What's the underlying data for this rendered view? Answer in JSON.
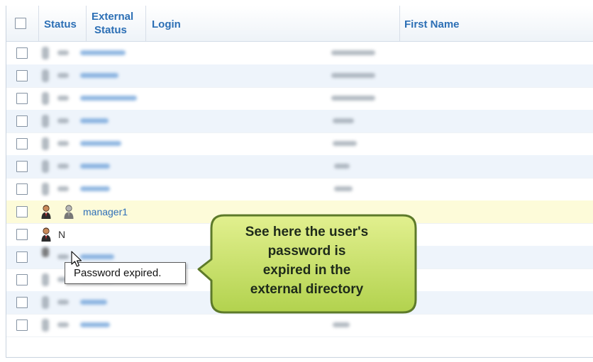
{
  "header": {
    "status": "Status",
    "external_status_line1": "External",
    "external_status_line2": "Status",
    "login": "Login",
    "first_name": "First Name"
  },
  "highlighted_row": {
    "login": "manager1"
  },
  "partial_row": {
    "login_fragment": "N"
  },
  "tooltip": {
    "text": "Password expired."
  },
  "callout": {
    "line1": "See here the user's",
    "line2": "password is",
    "line3": "expired in the",
    "line4": "external directory"
  },
  "colors": {
    "header_text": "#2c6fb5",
    "row_alt": "#eef4fb",
    "row_highlight": "#fdfbd9",
    "callout_fill": "#c6e06a",
    "callout_border": "#5d7a2a",
    "link": "#2f6fb8"
  },
  "icons": {
    "user": "user-icon",
    "external_user_expired": "user-expired-icon",
    "pointer": "mouse-pointer-icon"
  }
}
